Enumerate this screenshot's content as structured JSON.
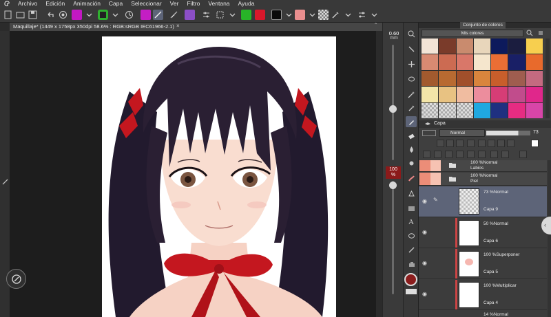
{
  "menu": {
    "items": [
      "Archivo",
      "Edición",
      "Animación",
      "Capa",
      "Seleccionar",
      "Ver",
      "Filtro",
      "Ventana",
      "Ayuda"
    ]
  },
  "document": {
    "tab_title": "Maquillaje* (1449 x 1758px 350dpi 58.6% : RGB:sRGB IEC61966-2.1)",
    "close_glyph": "×"
  },
  "brush": {
    "size_value": "0.60",
    "size_unit": "mm",
    "opacity_value": "100",
    "opacity_unit": "%"
  },
  "color_set": {
    "tab_label": "Conjunto de colores",
    "palette_name": "Mis colores",
    "swatches": [
      "#f3e4d6",
      "#7a3b2a",
      "#c98b6e",
      "#e8d6bb",
      "#0d1a5c",
      "#1b1d3f",
      "#f7cf4f",
      "#d88a72",
      "#cc6b52",
      "#d97769",
      "#f5e6cd",
      "#ea6e35",
      "#191f66",
      "#e86a2c",
      "#a25a2e",
      "#b86a31",
      "#a14f2b",
      "#d9853d",
      "#c85e2b",
      "#9f5d4f",
      "#c46a80",
      "#f3e5a8",
      "#e8c282",
      "#f0bca0",
      "#ec8d9d",
      "#d63d76",
      "#c14c8c",
      "#e0278b",
      "empty",
      "empty",
      "empty",
      "#20a8e0",
      "#1f3080",
      "#e62c82",
      "#d845a8"
    ]
  },
  "layers_panel": {
    "tab_label": "Capa",
    "blend_mode": "Normal",
    "opacity": 73,
    "opacity_label": "73",
    "layers": [
      {
        "blend": "100 %Normal",
        "name": "Labios",
        "type": "folder",
        "selected": false
      },
      {
        "blend": "100 %Normal",
        "name": "Piel",
        "type": "folder",
        "selected": false
      },
      {
        "blend": "73 %Normal",
        "name": "Capa 9",
        "type": "raster",
        "selected": true
      },
      {
        "blend": "50 %Normal",
        "name": "Capa 6",
        "type": "raster",
        "selected": false
      },
      {
        "blend": "100 %Superponer",
        "name": "Capa 5",
        "type": "raster",
        "selected": false
      },
      {
        "blend": "100 %Multiplicar",
        "name": "Capa 4",
        "type": "raster",
        "selected": false
      },
      {
        "blend": "14 %Normal",
        "name": "",
        "type": "raster",
        "selected": false
      }
    ]
  },
  "colors": {
    "accent_selected": "#5d6478",
    "main_color": "#8b1d1d",
    "hair": "#2a1f33",
    "skin": "#f9ddd0",
    "ribbon": "#c4171f"
  }
}
